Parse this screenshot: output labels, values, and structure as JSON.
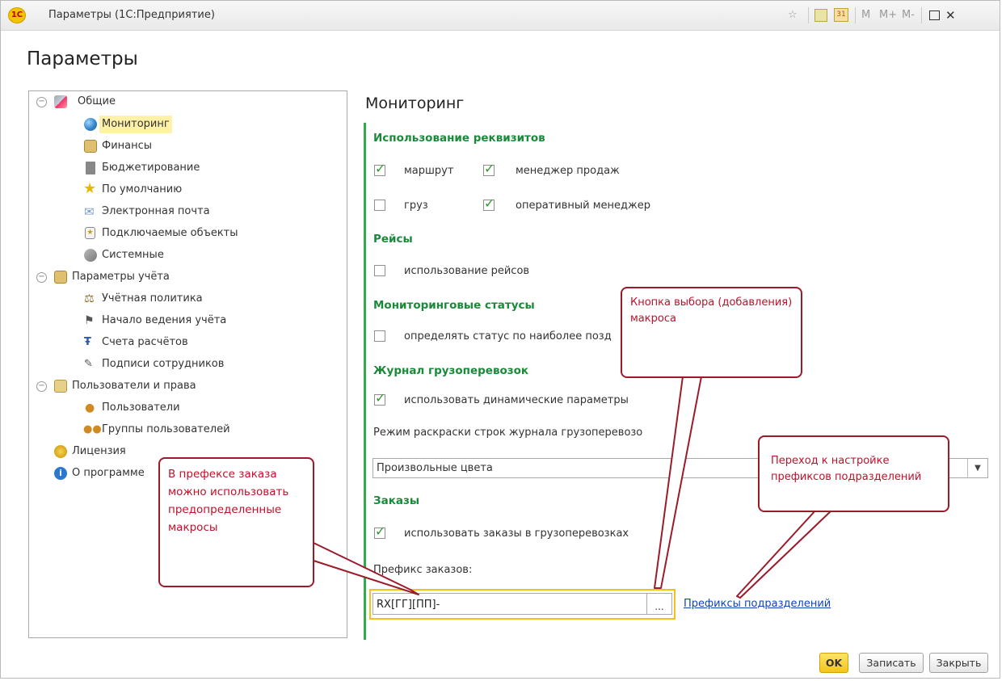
{
  "window": {
    "app_logo": "1С",
    "title": "Параметры (1С:Предприятие)",
    "toolbar_right": [
      "M",
      "M+",
      "M-"
    ],
    "calendar_day": "31"
  },
  "page_heading": "Параметры",
  "tree": {
    "general": "Общие",
    "monitoring": "Мониторинг",
    "finance": "Финансы",
    "budgeting": "Бюджетирование",
    "defaults": "По умолчанию",
    "email": "Электронная почта",
    "plugins": "Подключаемые объекты",
    "system": "Системные",
    "accounting_params": "Параметры учёта",
    "accounting_policy": "Учётная политика",
    "accounting_start": "Начало ведения учёта",
    "settlement_accounts": "Счета расчётов",
    "employee_signatures": "Подписи сотрудников",
    "users_rights": "Пользователи и права",
    "users": "Пользователи",
    "user_groups": "Группы пользователей",
    "license": "Лицензия",
    "about": "О программе"
  },
  "section_title": "Мониторинг",
  "groups": {
    "attributes": "Использование реквизитов",
    "trips": "Рейсы",
    "statuses": "Мониторинговые статусы",
    "journal": "Журнал грузоперевозок",
    "orders": "Заказы"
  },
  "checkboxes": {
    "route": {
      "label": "маршрут",
      "checked": true
    },
    "sales_manager": {
      "label": "менеджер продаж",
      "checked": true
    },
    "cargo": {
      "label": "груз",
      "checked": false
    },
    "operational_manager": {
      "label": "оперативный менеджер",
      "checked": true
    },
    "use_trips": {
      "label": "использование рейсов",
      "checked": false
    },
    "status_latest": {
      "label": "определять статус по наиболее позд",
      "checked": false
    },
    "dynamic_params": {
      "label": "использовать динамические параметры",
      "checked": true
    },
    "orders_in_transport": {
      "label": "использовать заказы в грузоперевозках",
      "checked": true
    }
  },
  "check_glyph": "✓",
  "coloring_mode_label": "Режим раскраски строк журнала грузоперевозо",
  "coloring_mode_value": "Произвольные цвета",
  "order_prefix_label": "Префикс заказов:",
  "order_prefix_value": "RX[ГГ][ПП]-",
  "choice_button_label": "...",
  "units_prefix_link": "Префиксы подразделений",
  "buttons": {
    "ok": "OK",
    "save": "Записать",
    "close": "Закрыть"
  },
  "callouts": {
    "macro_button": "Кнопка выбора (добавления) макроса",
    "prefix_macros": "В префексе заказа можно использовать предопределенные макросы",
    "units_prefix": "Переход к настройке префиксов подразделений"
  },
  "colors": {
    "group_green": "#1a8a3a",
    "accent_bar": "#34a853",
    "callout_border": "#9b1b2a",
    "callout_text": "#c0102a",
    "highlight": "#f2c21a",
    "link": "#1144bb"
  }
}
